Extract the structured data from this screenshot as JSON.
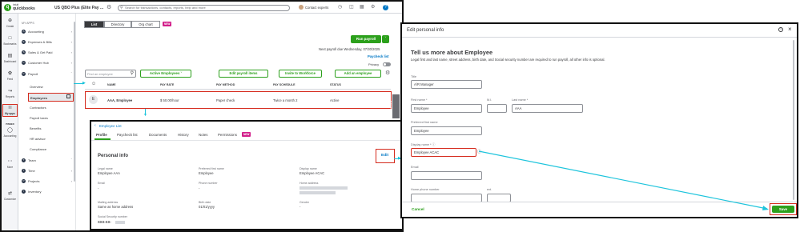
{
  "topbar": {
    "logo_top": "intuit",
    "logo_bottom": "quickbooks",
    "company": "US QBO Plus (Elite Pay ...",
    "search_placeholder": "Search for transactions, contacts, reports, help and more",
    "contact_label": "Contact experts"
  },
  "rail": {
    "items": [
      "Create",
      "Bookmarks",
      "Dashboard",
      "Feed",
      "Reports",
      "My apps",
      "Accounting",
      "More",
      "Customize"
    ],
    "badge": "PINNED"
  },
  "sidebar": {
    "header": "MY APPS",
    "items": [
      "Accounting",
      "Expenses & Bills",
      "Sales & Get Paid",
      "Customer Hub",
      "Payroll"
    ],
    "payroll_subitems": [
      "Overview",
      "Employees",
      "Contractors",
      "Payroll taxes",
      "Benefits",
      "HR advisor",
      "Compliance"
    ],
    "lower_items": [
      "Team",
      "Time",
      "Projects",
      "Inventory"
    ]
  },
  "tabs": [
    "List",
    "Directory",
    "Org chart"
  ],
  "tab_badge": "NEW",
  "payroll": {
    "run_payroll": "Run payroll",
    "next_payroll": "Next payroll due Wednesday, 07/30/2025",
    "paycheck_list": "Paycheck list",
    "privacy": "Privacy",
    "find_placeholder": "Find an employee",
    "filter": "Active Employees",
    "edit_payroll_items": "Edit payroll items",
    "invite": "Invite to Workforce",
    "add_employee": "Add an employee",
    "feedback": "Feedback"
  },
  "table": {
    "headers": [
      "NAME",
      "PAY RATE",
      "PAY METHOD",
      "PAY SCHEDULE",
      "STATUS"
    ],
    "row": {
      "initial": "E",
      "name": "AAA, Employee",
      "pay_rate": "$ 50.00/hour",
      "pay_method": "Paper check",
      "pay_schedule": "Twice a month 2",
      "status": "Active"
    }
  },
  "detail": {
    "breadcrumb": "Employee List",
    "tabs": [
      "Profile",
      "Paycheck list",
      "Documents",
      "History",
      "Notes",
      "Permissions"
    ],
    "tabs_badge": "NEW",
    "section_title": "Personal info",
    "edit": "Edit",
    "fields": {
      "legal_name_label": "Legal name",
      "legal_name": "Employee AAA",
      "preferred_label": "Preferred first name",
      "preferred": "Employee",
      "display_label": "Display name",
      "display": "Employee ACAC",
      "email_label": "Email",
      "email": "-",
      "phone_label": "Phone number",
      "phone": "-",
      "home_label": "Home address",
      "mailing_label": "Mailing address",
      "mailing": "Same as home address",
      "birth_label": "Birth date",
      "birth": "01/01/yyyy",
      "gender_label": "Gender",
      "gender": "-",
      "ssn_label": "Social Security number",
      "ssn": "XXX-XX-"
    }
  },
  "modal": {
    "title": "Edit personal info",
    "heading": "Tell us more about Employee",
    "subtext": "Legal first and last name, street address, birth date, and Social security number are required to run payroll, all other info is optional.",
    "title_label": "Title",
    "title_value": "A/R Manager",
    "first_label": "First name *",
    "first_value": "Employee",
    "mi_label": "M.I.",
    "last_label": "Last name *",
    "last_value": "AAA",
    "preferred_label": "Preferred first name",
    "preferred_value": "Employee",
    "display_label": "Display name *",
    "display_value": "Employee ACAC",
    "email_label": "Email",
    "home_phone_label": "Home phone number",
    "ext_label": "ext.",
    "cancel": "Cancel",
    "save": "Save"
  },
  "colors": {
    "brand_green": "#2ca01c",
    "highlight_red": "#d52b1e",
    "arrow_cyan": "#1dc4dc"
  }
}
